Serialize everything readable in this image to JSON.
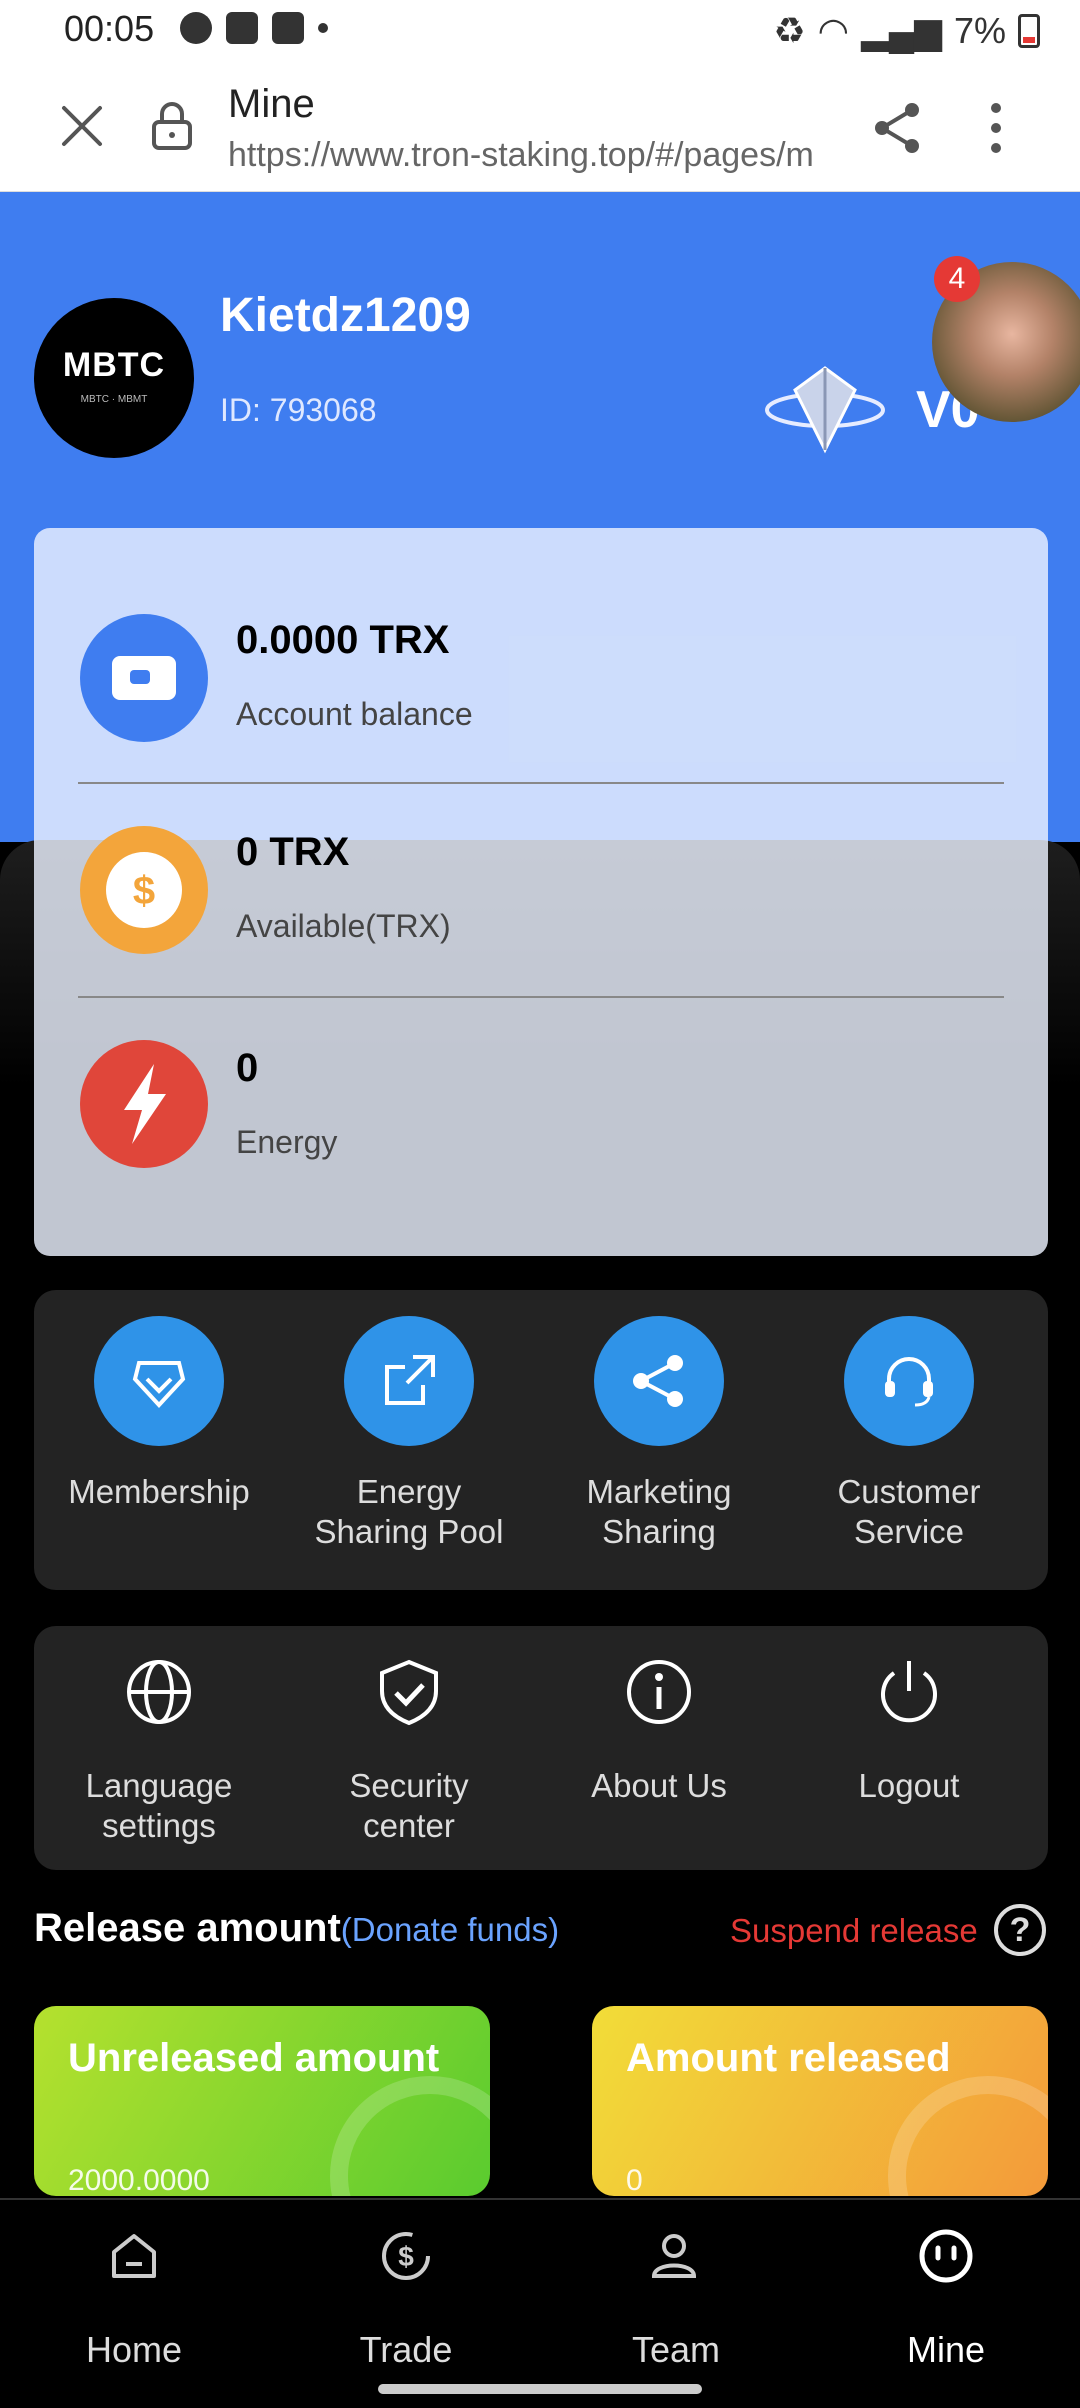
{
  "status_bar": {
    "time": "00:05",
    "battery": "7%"
  },
  "browser": {
    "title": "Mine",
    "url": "https://www.tron-staking.top/#/pages/m"
  },
  "profile": {
    "logo_text": "MBTC",
    "logo_sub": "MBTC · MBMT",
    "username": "Kietdz1209",
    "user_id": "ID: 793068",
    "vip_level": "V0",
    "notification_count": "4"
  },
  "balances": [
    {
      "value": "0.0000 TRX",
      "label": "Account balance",
      "icon": "wallet-icon",
      "color": "#3f7df0"
    },
    {
      "value": "0 TRX",
      "label": "Available(TRX)",
      "icon": "dollar-coin-icon",
      "color": "#f3a53b"
    },
    {
      "value": "0",
      "label": "Energy",
      "icon": "lightning-icon",
      "color": "#e0463a"
    }
  ],
  "functions": [
    {
      "label_lines": [
        "Membership"
      ],
      "icon": "diamond-icon"
    },
    {
      "label_lines": [
        "Energy",
        "Sharing Pool"
      ],
      "icon": "external-link-icon"
    },
    {
      "label_lines": [
        "Marketing",
        "Sharing"
      ],
      "icon": "share-icon"
    },
    {
      "label_lines": [
        "Customer",
        "Service"
      ],
      "icon": "headset-icon"
    }
  ],
  "settings": [
    {
      "label_lines": [
        "Language",
        "settings"
      ],
      "icon": "globe-icon"
    },
    {
      "label_lines": [
        "Security",
        "center"
      ],
      "icon": "shield-check-icon"
    },
    {
      "label_lines": [
        "About Us"
      ],
      "icon": "info-icon"
    },
    {
      "label_lines": [
        "Logout"
      ],
      "icon": "power-icon"
    }
  ],
  "release": {
    "title": "Release amount",
    "donate": "(Donate funds)",
    "suspend": "Suspend release",
    "help": "?",
    "unreleased_label": "Unreleased amount",
    "unreleased_value": "2000.0000",
    "released_label": "Amount released",
    "released_value": "0"
  },
  "nav": [
    {
      "label": "Home",
      "icon": "home-icon"
    },
    {
      "label": "Trade",
      "icon": "trade-icon"
    },
    {
      "label": "Team",
      "icon": "team-icon"
    },
    {
      "label": "Mine",
      "icon": "mine-icon",
      "active": true
    }
  ]
}
